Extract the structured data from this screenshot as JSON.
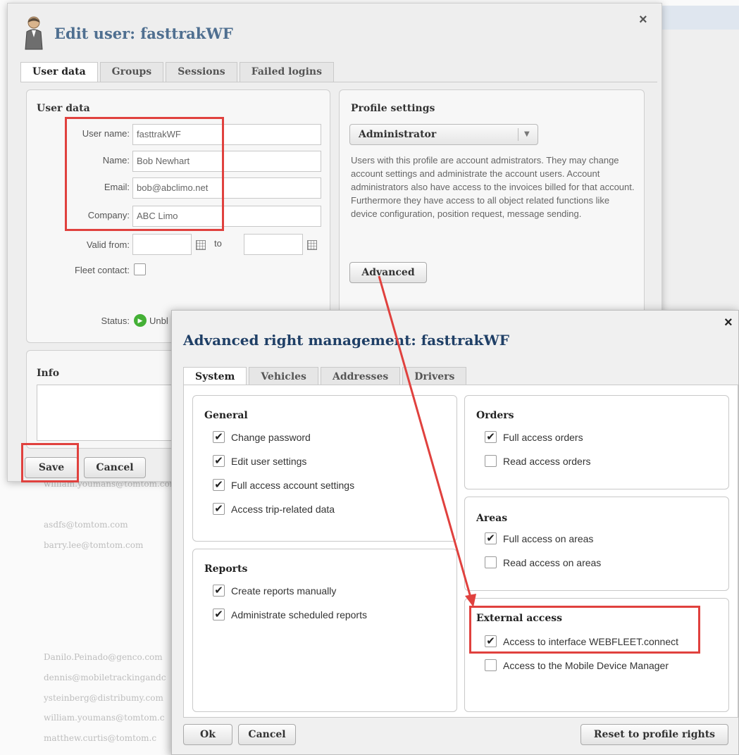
{
  "background": {
    "emails": [
      "william.youmans@tomtom.com",
      "asdfs@tomtom.com",
      "barry.lee@tomtom.com",
      "Danilo.Peinado@genco.com",
      "dennis@mobiletrackingandc",
      "ysteinberg@distribumy.com",
      "william.youmans@tomtom.c",
      "matthew.curtis@tomtom.c"
    ]
  },
  "user_dialog": {
    "title": "Edit user: fasttrakWF",
    "close": "×",
    "tabs": [
      {
        "label": "User data",
        "active": true
      },
      {
        "label": "Groups",
        "active": false
      },
      {
        "label": "Sessions",
        "active": false
      },
      {
        "label": "Failed logins",
        "active": false
      }
    ],
    "user_data": {
      "heading": "User data",
      "username_label": "User name:",
      "username_value": "fasttrakWF",
      "name_label": "Name:",
      "name_value": "Bob Newhart",
      "email_label": "Email:",
      "email_value": "bob@abclimo.net",
      "company_label": "Company:",
      "company_value": "ABC Limo",
      "valid_from_label": "Valid from:",
      "valid_to_label": "to",
      "fleet_contact_label": "Fleet contact:",
      "status_label": "Status:",
      "status_value": "Unbl"
    },
    "profile": {
      "heading": "Profile settings",
      "selected": "Administrator",
      "description": "Users with this profile are account admistrators. They may change account settings and administrate the account users. Account administrators also have access to the invoices billed for that account. Furthermore they have access to all object related functions like device configuration, position request, message sending.",
      "advanced_label": "Advanced"
    },
    "info": {
      "heading": "Info"
    },
    "save_label": "Save",
    "cancel_label": "Cancel"
  },
  "advanced_dialog": {
    "title": "Advanced right management: fasttrakWF",
    "close": "×",
    "tabs": [
      {
        "label": "System",
        "active": true
      },
      {
        "label": "Vehicles",
        "active": false
      },
      {
        "label": "Addresses",
        "active": false
      },
      {
        "label": "Drivers",
        "active": false
      }
    ],
    "general": {
      "heading": "General",
      "items": [
        {
          "label": "Change password",
          "checked": true
        },
        {
          "label": "Edit user settings",
          "checked": true
        },
        {
          "label": "Full access account settings",
          "checked": true
        },
        {
          "label": "Access trip-related data",
          "checked": true
        }
      ]
    },
    "reports": {
      "heading": "Reports",
      "items": [
        {
          "label": "Create reports manually",
          "checked": true
        },
        {
          "label": "Administrate scheduled reports",
          "checked": true
        }
      ]
    },
    "orders": {
      "heading": "Orders",
      "items": [
        {
          "label": "Full access orders",
          "checked": true
        },
        {
          "label": "Read access orders",
          "checked": false
        }
      ]
    },
    "areas": {
      "heading": "Areas",
      "items": [
        {
          "label": "Full access on areas",
          "checked": true
        },
        {
          "label": "Read access on areas",
          "checked": false
        }
      ]
    },
    "external": {
      "heading": "External access",
      "items": [
        {
          "label": "Access to interface WEBFLEET.connect",
          "checked": true
        },
        {
          "label": "Access to the Mobile Device Manager",
          "checked": false
        }
      ]
    },
    "ok_label": "Ok",
    "cancel_label": "Cancel",
    "reset_label": "Reset to profile rights"
  },
  "colors": {
    "highlight": "#e0413e",
    "title_blue": "#4f6f90",
    "adv_title_blue": "#1f3f66"
  }
}
